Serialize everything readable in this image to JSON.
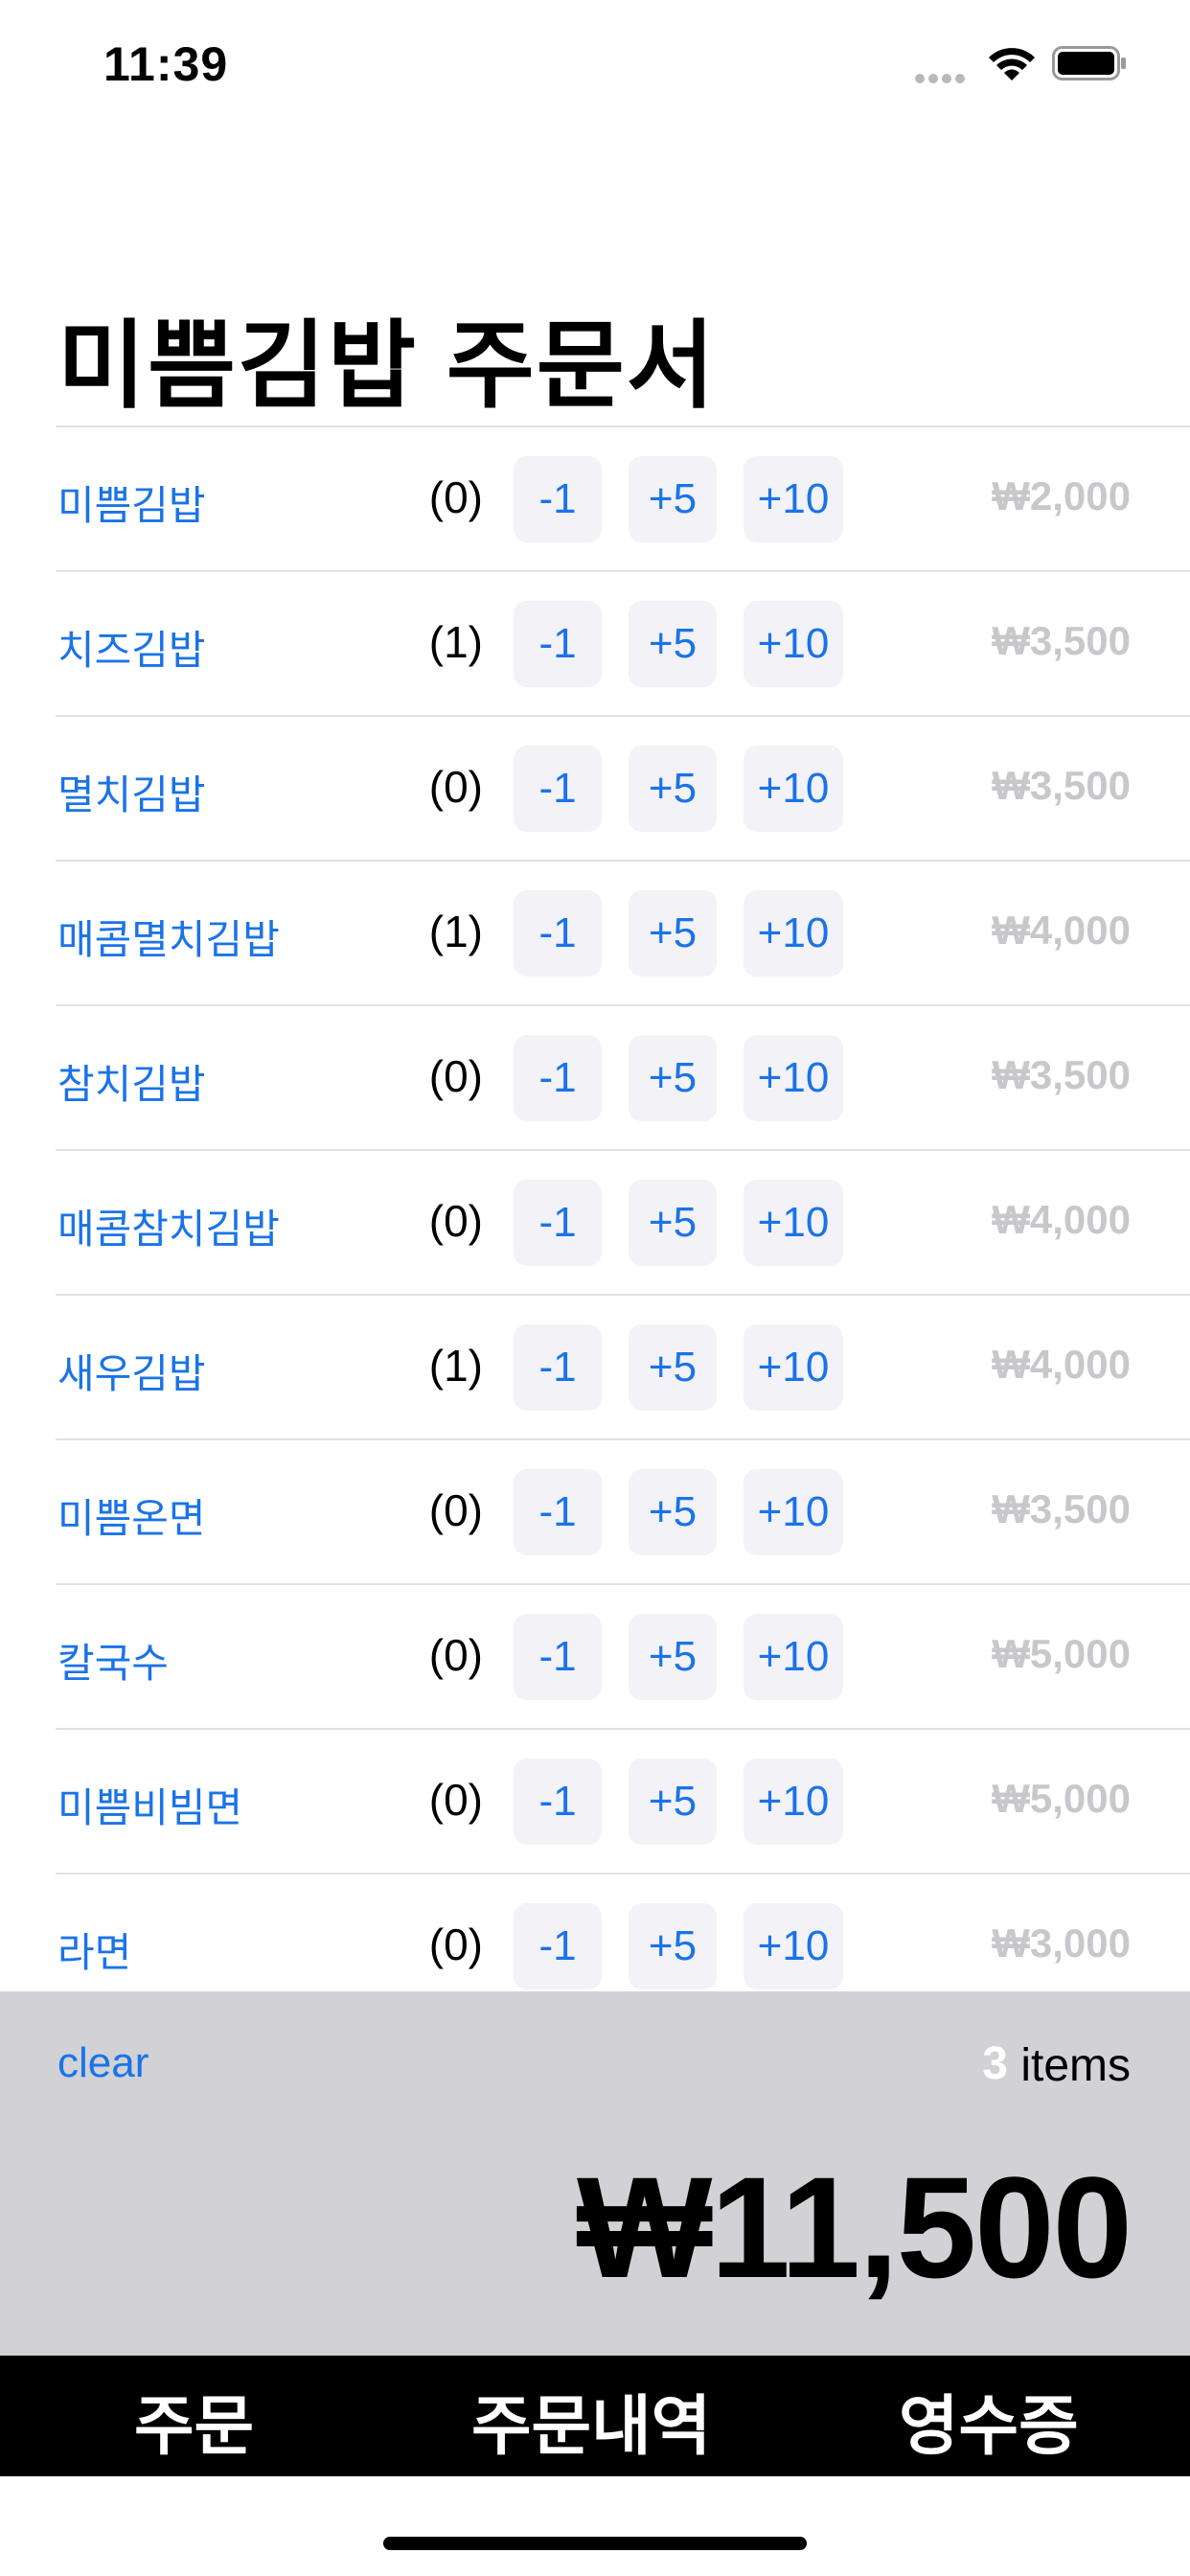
{
  "status_bar": {
    "time": "11:39"
  },
  "title": "미쁨김밥 주문서",
  "menu_items": [
    {
      "name": "미쁨김밥",
      "count": "(0)",
      "price": "₩2,000"
    },
    {
      "name": "치즈김밥",
      "count": "(1)",
      "price": "₩3,500"
    },
    {
      "name": "멸치김밥",
      "count": "(0)",
      "price": "₩3,500"
    },
    {
      "name": "매콤멸치김밥",
      "count": "(1)",
      "price": "₩4,000"
    },
    {
      "name": "참치김밥",
      "count": "(0)",
      "price": "₩3,500"
    },
    {
      "name": "매콤참치김밥",
      "count": "(0)",
      "price": "₩4,000"
    },
    {
      "name": "새우김밥",
      "count": "(1)",
      "price": "₩4,000"
    },
    {
      "name": "미쁨온면",
      "count": "(0)",
      "price": "₩3,500"
    },
    {
      "name": "칼국수",
      "count": "(0)",
      "price": "₩5,000"
    },
    {
      "name": "미쁨비빔면",
      "count": "(0)",
      "price": "₩5,000"
    },
    {
      "name": "라면",
      "count": "(0)",
      "price": "₩3,000"
    }
  ],
  "buttons": {
    "minus": "-1",
    "plus5": "+5",
    "plus10": "+10"
  },
  "summary": {
    "clear_label": "clear",
    "item_count": "3",
    "items_label": "items",
    "total": "₩11,500"
  },
  "tabs": [
    {
      "label": "주문"
    },
    {
      "label": "주문내역"
    },
    {
      "label": "영수증"
    }
  ],
  "colors": {
    "accent": "#1a73e8",
    "button_bg": "#f2f2f7",
    "price_text": "#c8c8cc",
    "summary_bg": "#d1d1d6",
    "tabbar_bg": "#000000"
  }
}
